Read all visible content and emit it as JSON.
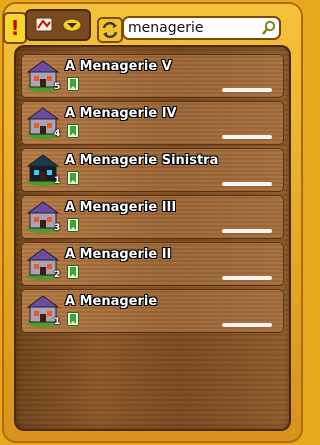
{
  "toolbar": {
    "alert_label": "!",
    "search_value": "menagerie"
  },
  "list": [
    {
      "name": "A Menagerie V",
      "level": "5",
      "variant": "normal"
    },
    {
      "name": "A Menagerie IV",
      "level": "4",
      "variant": "normal"
    },
    {
      "name": "A Menagerie Sinistra",
      "level": "1",
      "variant": "dark"
    },
    {
      "name": "A Menagerie III",
      "level": "3",
      "variant": "normal"
    },
    {
      "name": "A Menagerie II",
      "level": "2",
      "variant": "normal"
    },
    {
      "name": "A Menagerie",
      "level": "1",
      "variant": "normal"
    }
  ],
  "colors": {
    "frame": "#f0b52c",
    "panel": "#7a4a1e",
    "row": "#a66e3c",
    "bookmark": "#3fa338"
  }
}
